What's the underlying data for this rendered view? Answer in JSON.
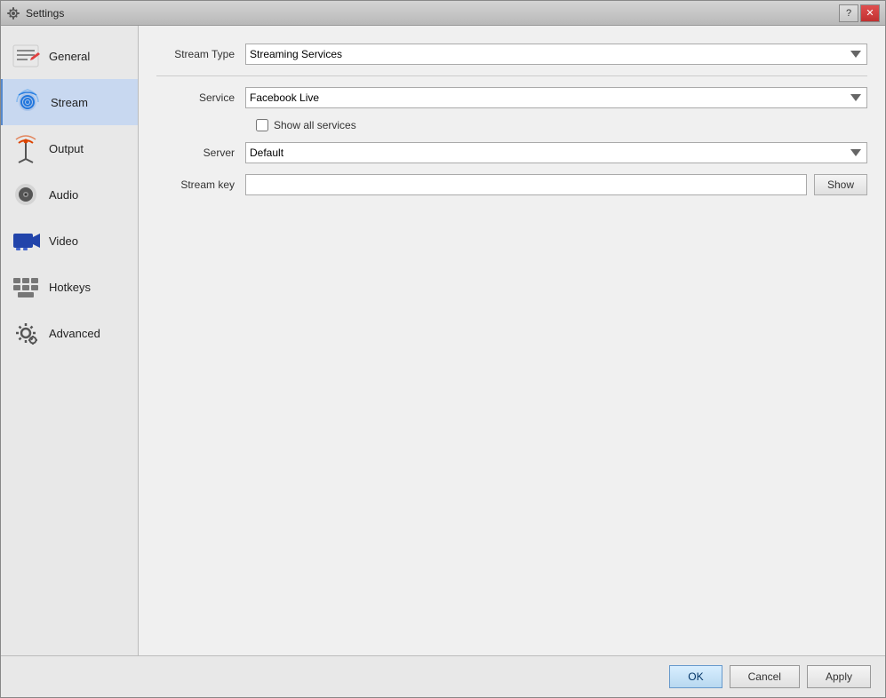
{
  "window": {
    "title": "Settings"
  },
  "sidebar": {
    "items": [
      {
        "id": "general",
        "label": "General",
        "active": false
      },
      {
        "id": "stream",
        "label": "Stream",
        "active": true
      },
      {
        "id": "output",
        "label": "Output",
        "active": false
      },
      {
        "id": "audio",
        "label": "Audio",
        "active": false
      },
      {
        "id": "video",
        "label": "Video",
        "active": false
      },
      {
        "id": "hotkeys",
        "label": "Hotkeys",
        "active": false
      },
      {
        "id": "advanced",
        "label": "Advanced",
        "active": false
      }
    ]
  },
  "stream_settings": {
    "stream_type_label": "Stream Type",
    "stream_type_value": "Streaming Services",
    "service_label": "Service",
    "service_value": "Facebook Live",
    "show_all_services_label": "Show all services",
    "server_label": "Server",
    "server_value": "Default",
    "stream_key_label": "Stream key",
    "stream_key_value": "",
    "show_button_label": "Show"
  },
  "buttons": {
    "ok_label": "OK",
    "cancel_label": "Cancel",
    "apply_label": "Apply"
  },
  "title_buttons": {
    "help_label": "?",
    "close_label": "✕"
  }
}
